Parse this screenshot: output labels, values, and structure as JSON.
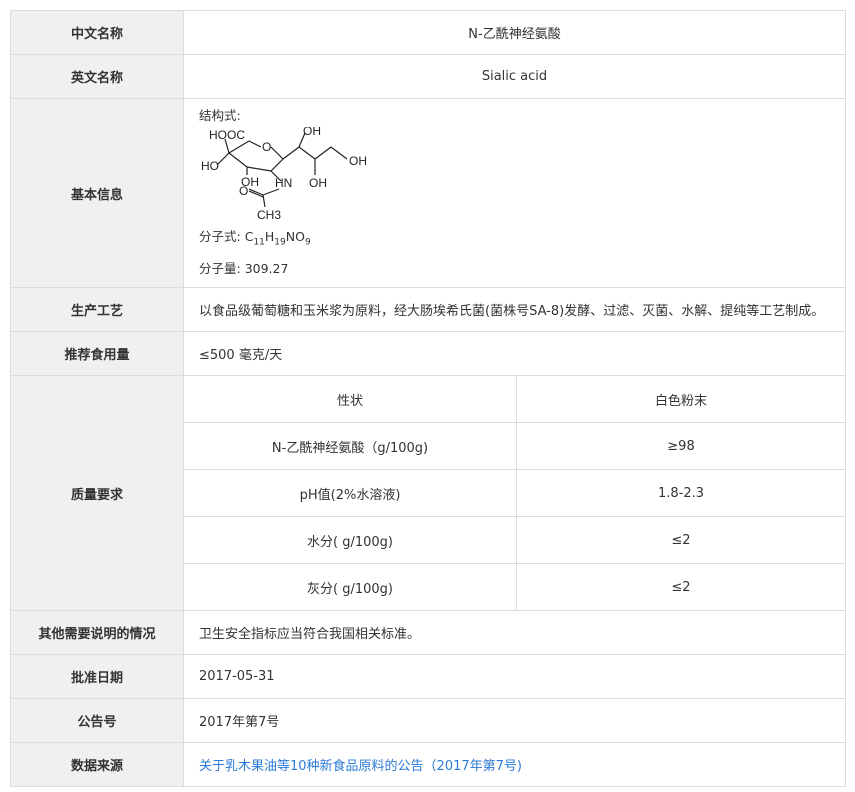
{
  "rows": {
    "chinese_name": {
      "label": "中文名称",
      "value": "N-乙酰神经氨酸"
    },
    "english_name": {
      "label": "英文名称",
      "value": "Sialic acid"
    },
    "basic_info": {
      "label": "基本信息",
      "structure_label": "结构式:",
      "structure_atoms": {
        "hooc": "HOOC",
        "o_ring": "O",
        "ho_left": "HO",
        "oh_ring": "OH",
        "hn": "HN",
        "oh_top": "OH",
        "oh_right": "OH",
        "oh_bottom": "OH",
        "o_acetyl": "O",
        "ch3": "CH3"
      },
      "formula_label": "分子式:",
      "formula": {
        "c": "C",
        "c_n": "11",
        "h": "H",
        "h_n": "19",
        "rest": "NO",
        "o_n": "9"
      },
      "mw_label": "分子量:",
      "mw_value": "309.27"
    },
    "production": {
      "label": "生产工艺",
      "value": "以食品级葡萄糖和玉米浆为原料，经大肠埃希氏菌(菌株号SA-8)发酵、过滤、灭菌、水解、提纯等工艺制成。"
    },
    "intake": {
      "label": "推荐食用量",
      "value": "≤500 毫克/天"
    },
    "quality": {
      "label": "质量要求",
      "items": [
        {
          "name": "性状",
          "value": "白色粉末"
        },
        {
          "name": "N-乙酰神经氨酸（g/100g)",
          "value": "≥98"
        },
        {
          "name": "pH值(2%水溶液)",
          "value": "1.8-2.3"
        },
        {
          "name": "水分( g/100g)",
          "value": "≤2"
        },
        {
          "name": "灰分( g/100g)",
          "value": "≤2"
        }
      ]
    },
    "other": {
      "label": "其他需要说明的情况",
      "value": "卫生安全指标应当符合我国相关标准。"
    },
    "approval_date": {
      "label": "批准日期",
      "value": "2017-05-31"
    },
    "announcement": {
      "label": "公告号",
      "value": "2017年第7号"
    },
    "source": {
      "label": "数据来源",
      "value": "关于乳木果油等10种新食品原料的公告（2017年第7号)"
    }
  }
}
